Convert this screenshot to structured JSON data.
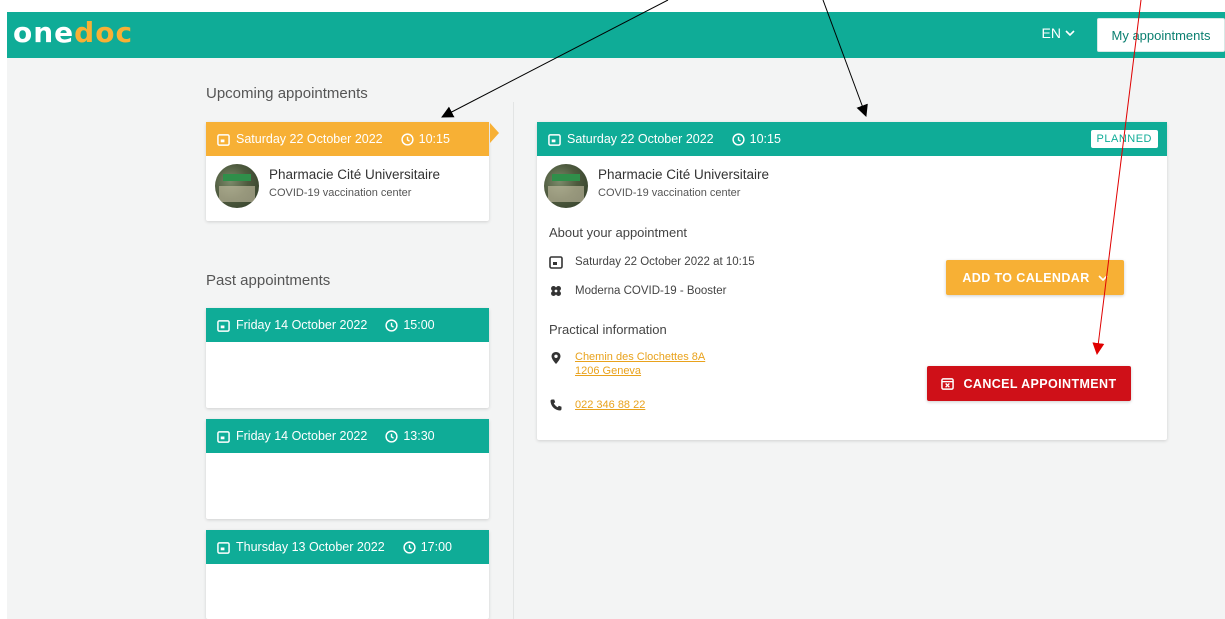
{
  "header": {
    "logo_part1": "one",
    "logo_part2": "doc",
    "language": "EN",
    "my_appointments": "My appointments"
  },
  "upcoming": {
    "title": "Upcoming appointments",
    "card": {
      "date": "Saturday 22 October 2022",
      "time": "10:15",
      "name": "Pharmacie Cité Universitaire",
      "type": "COVID-19 vaccination center"
    }
  },
  "past": {
    "title": "Past appointments",
    "items": [
      {
        "date": "Friday 14 October 2022",
        "time": "15:00"
      },
      {
        "date": "Friday 14 October 2022",
        "time": "13:30"
      },
      {
        "date": "Thursday 13 October 2022",
        "time": "17:00"
      }
    ]
  },
  "detail": {
    "date": "Saturday 22 October 2022",
    "time": "10:15",
    "status": "PLANNED",
    "name": "Pharmacie Cité Universitaire",
    "type": "COVID-19 vaccination center",
    "about_title": "About your appointment",
    "datetime": "Saturday 22 October 2022 at 10:15",
    "service": "Moderna COVID-19 - Booster",
    "practical_title": "Practical information",
    "address_line1": "Chemin des Clochettes 8A",
    "address_line2": "1206 Geneva",
    "phone": "022 346 88 22",
    "add_calendar": "ADD TO CALENDAR",
    "cancel": "CANCEL APPOINTMENT"
  },
  "colors": {
    "teal": "#0fac97",
    "orange": "#f7b035",
    "red": "#cf1018"
  }
}
